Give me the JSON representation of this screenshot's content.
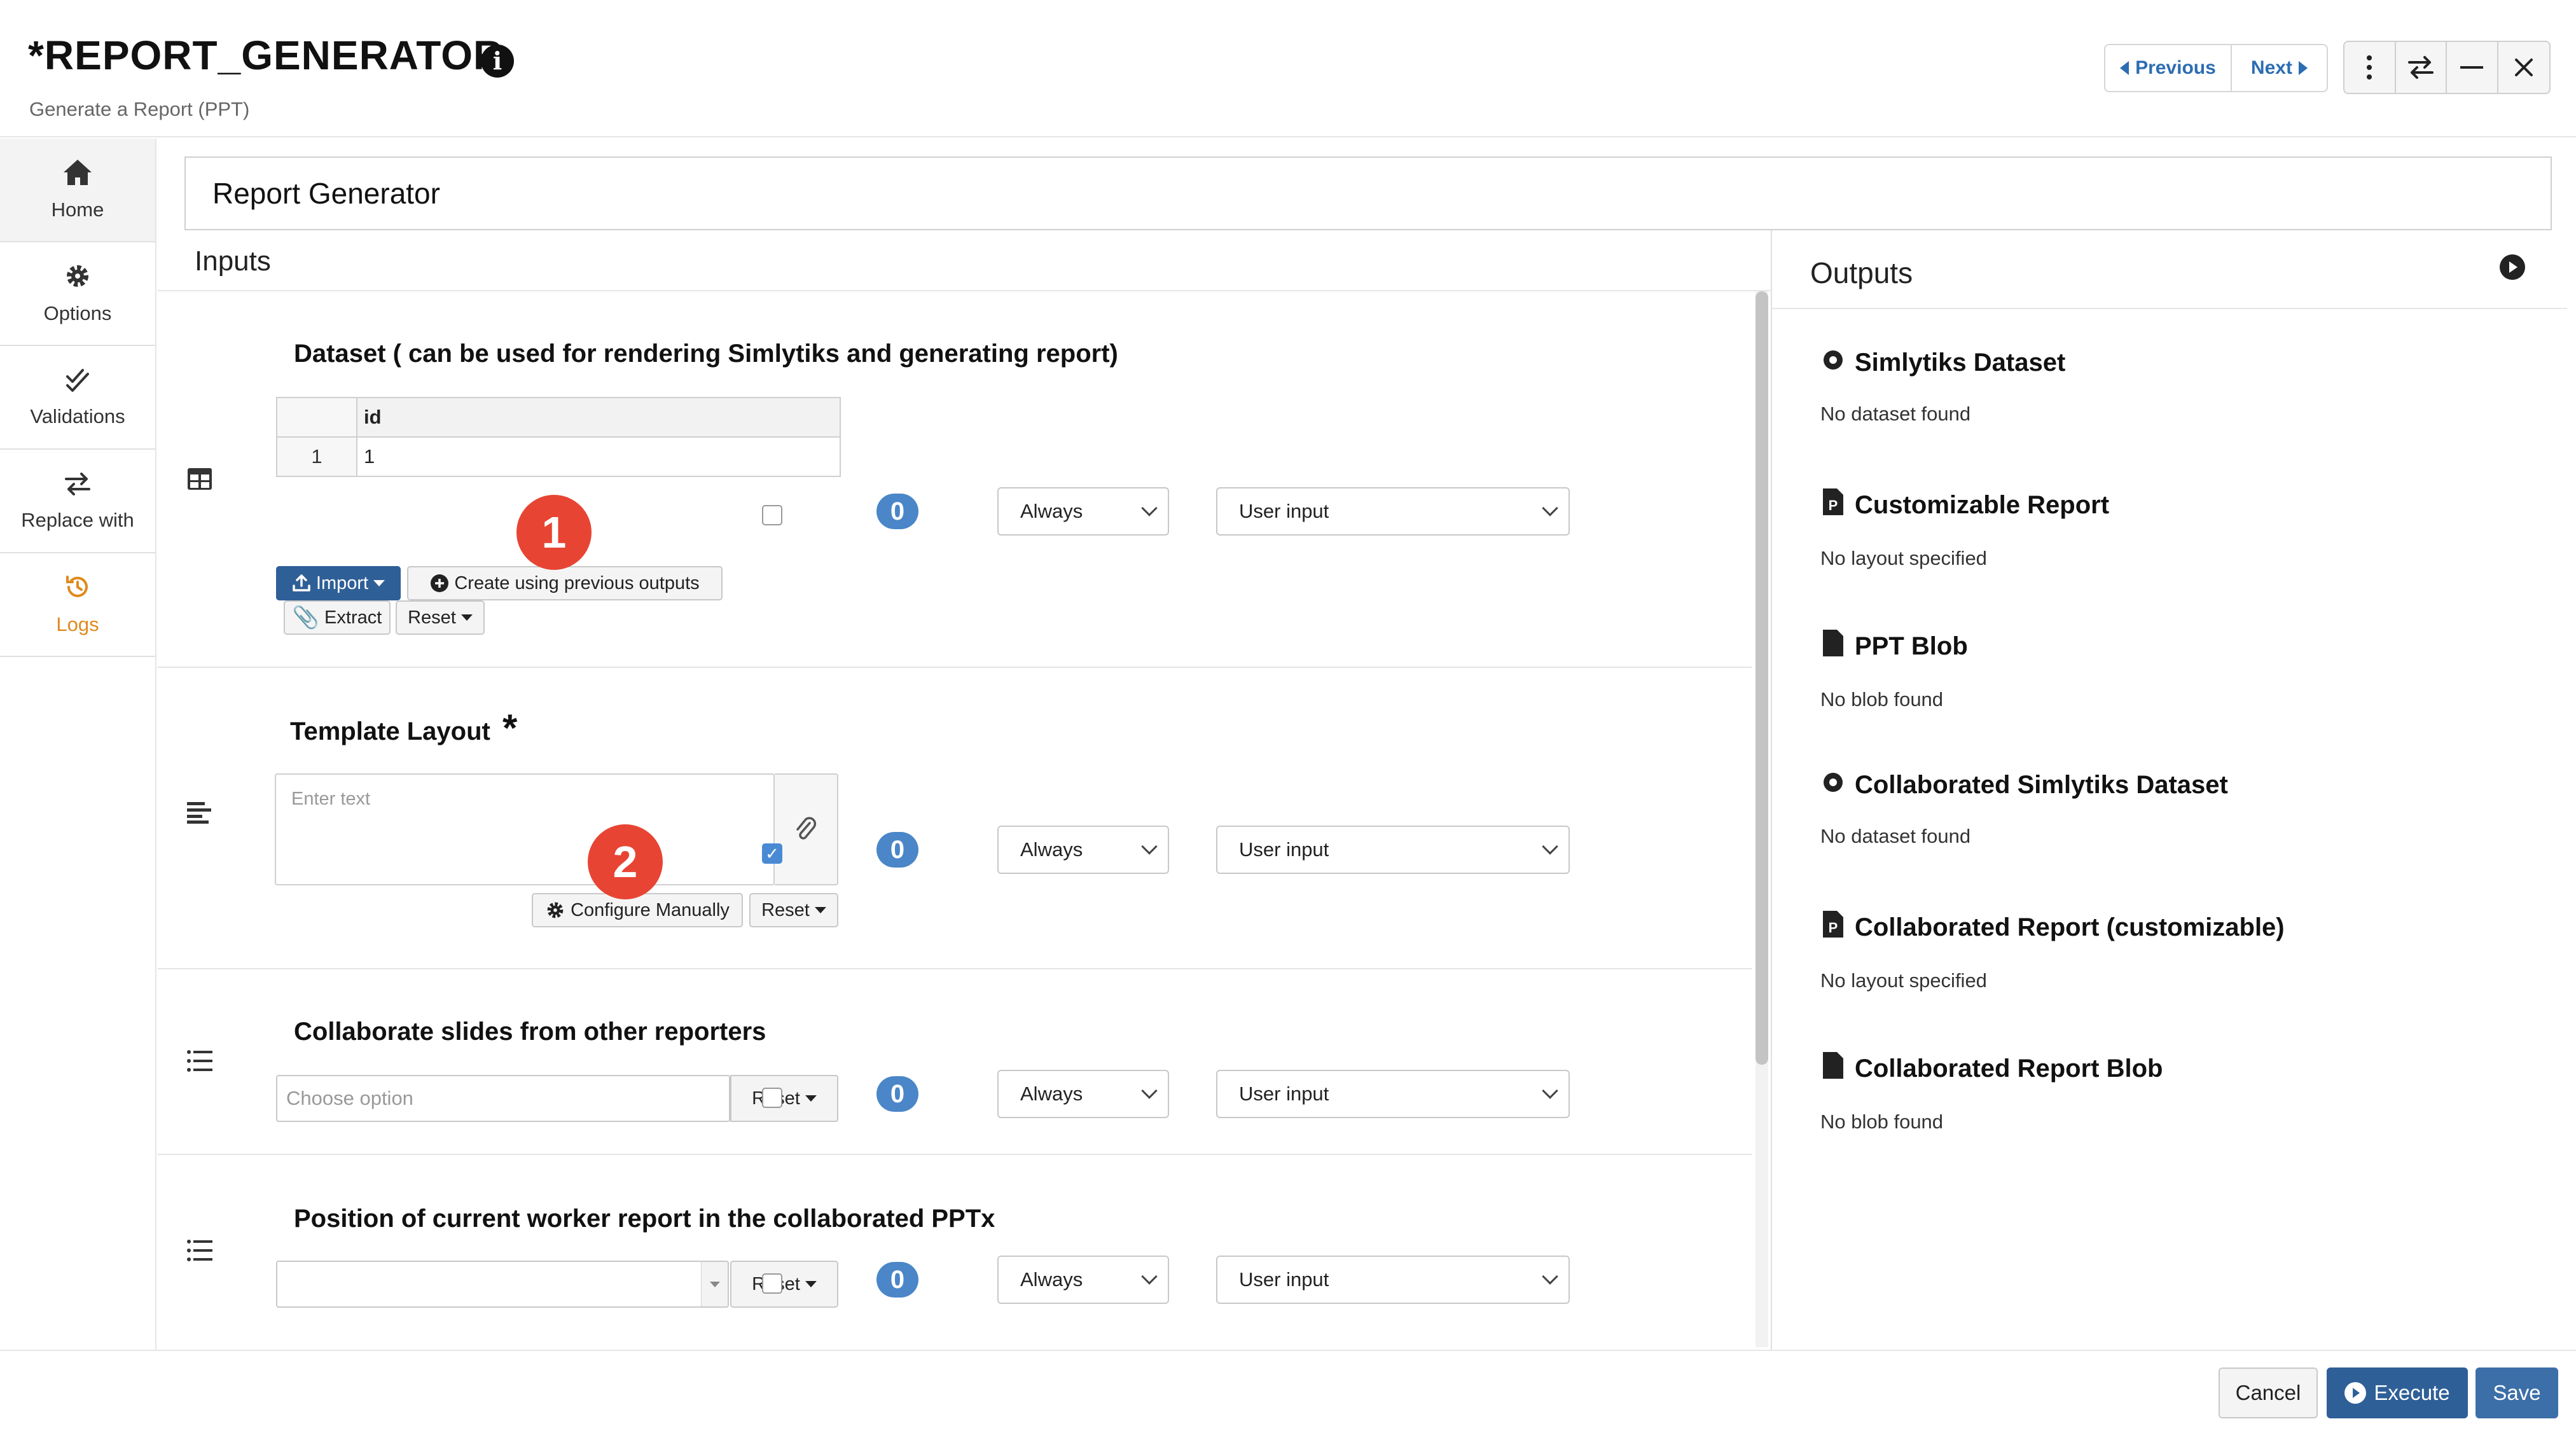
{
  "header": {
    "title": "*REPORT_GENERATOR",
    "subtitle": "Generate a Report (PPT)",
    "previous_label": "Previous",
    "next_label": "Next",
    "window_controls": [
      "more-vertical-icon",
      "swap-icon",
      "minimize-icon",
      "close-icon"
    ]
  },
  "sidebar": {
    "items": [
      {
        "label": "Home",
        "icon": "home-icon"
      },
      {
        "label": "Options",
        "icon": "gear-icon"
      },
      {
        "label": "Validations",
        "icon": "double-check-icon"
      },
      {
        "label": "Replace with",
        "icon": "swap-icon"
      },
      {
        "label": "Logs",
        "icon": "history-icon"
      }
    ],
    "logs_color": "#e08a1e"
  },
  "component_name": "Report Generator",
  "inputs": {
    "heading": "Inputs",
    "rows": [
      {
        "title": "Dataset ( can be used for rendering Simlytiks and generating report)",
        "table": {
          "columns": [
            "id"
          ],
          "rows": [
            [
              "1",
              "1"
            ]
          ]
        },
        "buttons": {
          "import": "Import",
          "create": "Create using previous outputs",
          "extract": "Extract",
          "reset": "Reset"
        },
        "count": "0",
        "frequency": "Always",
        "source": "User input",
        "checked": false
      },
      {
        "title": "Template Layout",
        "required_mark": "*",
        "placeholder": "Enter text",
        "buttons": {
          "configure": "Configure Manually",
          "reset": "Reset"
        },
        "count": "0",
        "frequency": "Always",
        "source": "User input",
        "checked": true
      },
      {
        "title": "Collaborate slides from other reporters",
        "placeholder": "Choose option",
        "buttons": {
          "reset": "Reset"
        },
        "count": "0",
        "frequency": "Always",
        "source": "User input",
        "checked": false
      },
      {
        "title": "Position of current worker report in the collaborated PPTx",
        "placeholder": "",
        "buttons": {
          "reset": "Reset"
        },
        "count": "0",
        "frequency": "Always",
        "source": "User input",
        "checked": false
      }
    ]
  },
  "callouts": [
    "1",
    "2"
  ],
  "outputs": {
    "heading": "Outputs",
    "items": [
      {
        "title": "Simlytiks Dataset",
        "status": "No dataset found",
        "icon": "dataset-icon"
      },
      {
        "title": "Customizable Report",
        "status": "No layout specified",
        "icon": "ppt-file-icon"
      },
      {
        "title": "PPT Blob",
        "status": "No blob found",
        "icon": "file-icon"
      },
      {
        "title": "Collaborated Simlytiks Dataset",
        "status": "No dataset found",
        "icon": "dataset-icon"
      },
      {
        "title": "Collaborated Report (customizable)",
        "status": "No layout specified",
        "icon": "ppt-file-icon"
      },
      {
        "title": "Collaborated Report Blob",
        "status": "No blob found",
        "icon": "file-icon"
      }
    ]
  },
  "footer": {
    "cancel": "Cancel",
    "execute": "Execute",
    "save": "Save"
  },
  "colors": {
    "primary": "#2f5f97",
    "badge": "#4a86c8",
    "callout": "#e84434",
    "link": "#2c6db3"
  }
}
